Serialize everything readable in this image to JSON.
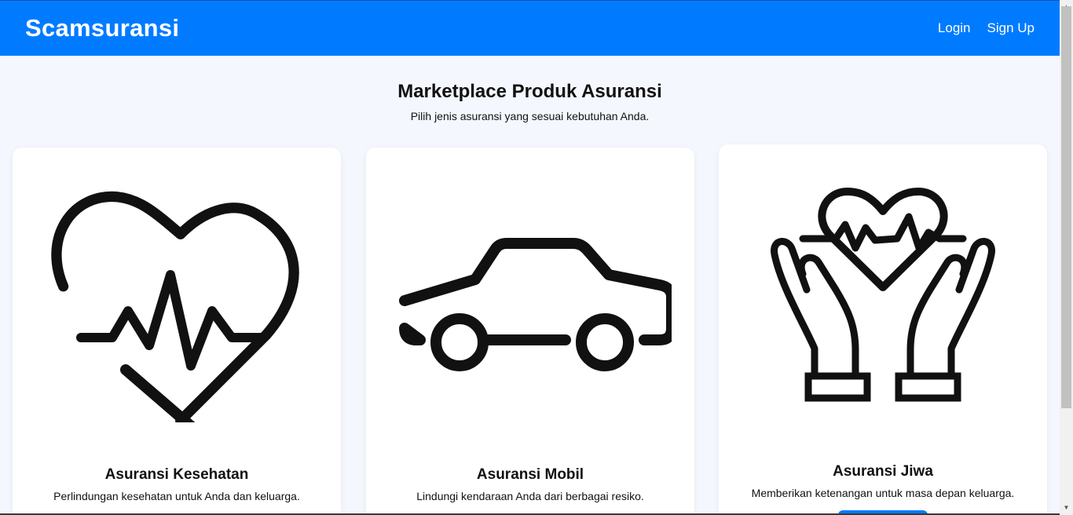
{
  "navbar": {
    "brand": "Scamsuransi",
    "links": [
      {
        "label": "Login"
      },
      {
        "label": "Sign Up"
      }
    ],
    "bg_color": "#007bff"
  },
  "main": {
    "title": "Marketplace Produk Asuransi",
    "subtitle": "Pilih jenis asuransi yang sesuai kebutuhan Anda."
  },
  "products": [
    {
      "icon": "heart-pulse-icon",
      "title": "Asuransi Kesehatan",
      "description": "Perlindungan kesehatan untuk Anda dan keluarga."
    },
    {
      "icon": "car-icon",
      "title": "Asuransi Mobil",
      "description": "Lindungi kendaraan Anda dari berbagai resiko."
    },
    {
      "icon": "hands-heart-icon",
      "title": "Asuransi Jiwa",
      "description": "Memberikan ketenangan untuk masa depan keluarga."
    }
  ]
}
